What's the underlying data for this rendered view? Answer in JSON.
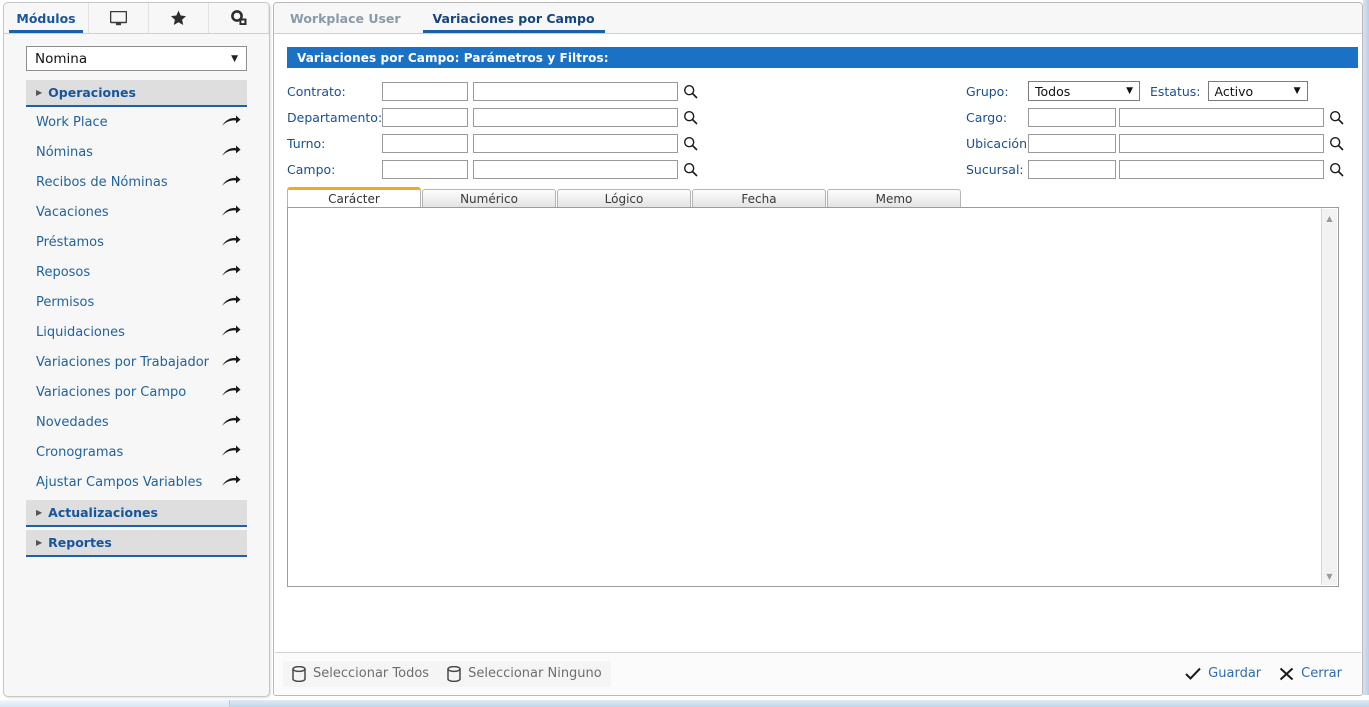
{
  "sidebar": {
    "tabs": [
      {
        "label": "Módulos",
        "icon": "text",
        "active": true
      },
      {
        "label": "",
        "icon": "monitor-icon",
        "active": false
      },
      {
        "label": "",
        "icon": "star-icon",
        "active": false
      },
      {
        "label": "",
        "icon": "gears-icon",
        "active": false
      }
    ],
    "module_select": {
      "value": "Nomina",
      "caret": "▼"
    },
    "groups": [
      {
        "label": "Operaciones",
        "marker": "▶"
      },
      {
        "label": "Actualizaciones",
        "marker": "▶"
      },
      {
        "label": "Reportes",
        "marker": "▶"
      }
    ],
    "items": [
      {
        "label": "Work Place"
      },
      {
        "label": "Nóminas"
      },
      {
        "label": "Recibos de Nóminas"
      },
      {
        "label": "Vacaciones"
      },
      {
        "label": "Préstamos"
      },
      {
        "label": "Reposos"
      },
      {
        "label": "Permisos"
      },
      {
        "label": "Liquidaciones"
      },
      {
        "label": "Variaciones por Trabajador"
      },
      {
        "label": "Variaciones por Campo"
      },
      {
        "label": "Novedades"
      },
      {
        "label": "Cronogramas"
      },
      {
        "label": "Ajustar Campos Variables"
      }
    ]
  },
  "main": {
    "tabs": [
      {
        "label": "Workplace User",
        "active": false
      },
      {
        "label": "Variaciones por Campo",
        "active": true
      }
    ],
    "section_header": "Variaciones por Campo: Parámetros y Filtros:",
    "filters_left": [
      {
        "label": "Contrato:",
        "code": "",
        "name": "",
        "search_icon": "search-icon"
      },
      {
        "label": "Departamento:",
        "code": "",
        "name": "",
        "search_icon": "search-icon"
      },
      {
        "label": "Turno:",
        "code": "",
        "name": "",
        "search_icon": "search-icon"
      },
      {
        "label": "Campo:",
        "code": "",
        "name": "",
        "search_icon": "search-icon"
      }
    ],
    "filters_right": {
      "grupo": {
        "label": "Grupo:",
        "value": "Todos",
        "caret": "▼"
      },
      "estatus": {
        "label": "Estatus:",
        "value": "Activo",
        "caret": "▼"
      },
      "rows": [
        {
          "label": "Cargo:",
          "code": "",
          "name": "",
          "search_icon": "search-icon"
        },
        {
          "label": "Ubicación:",
          "code": "",
          "name": "",
          "search_icon": "search-icon"
        },
        {
          "label": "Sucursal:",
          "code": "",
          "name": "",
          "search_icon": "search-icon"
        }
      ]
    },
    "inner_tabs": [
      {
        "label": "Carácter",
        "active": true
      },
      {
        "label": "Numérico",
        "active": false
      },
      {
        "label": "Lógico",
        "active": false
      },
      {
        "label": "Fecha",
        "active": false
      },
      {
        "label": "Memo",
        "active": false
      }
    ],
    "grid": {
      "rows": [],
      "scroll_up": "▲",
      "scroll_down": "▼"
    },
    "bottom_bar": {
      "select_all": "Seleccionar Todos",
      "select_none": "Seleccionar Ninguno",
      "save": "Guardar",
      "close": "Cerrar"
    }
  },
  "colors": {
    "accent_blue": "#1b72c4",
    "tab_underline": "#1960ad",
    "link_blue": "#21639e",
    "active_tab_orange": "#f0a92a",
    "group_bg": "#dedede"
  }
}
